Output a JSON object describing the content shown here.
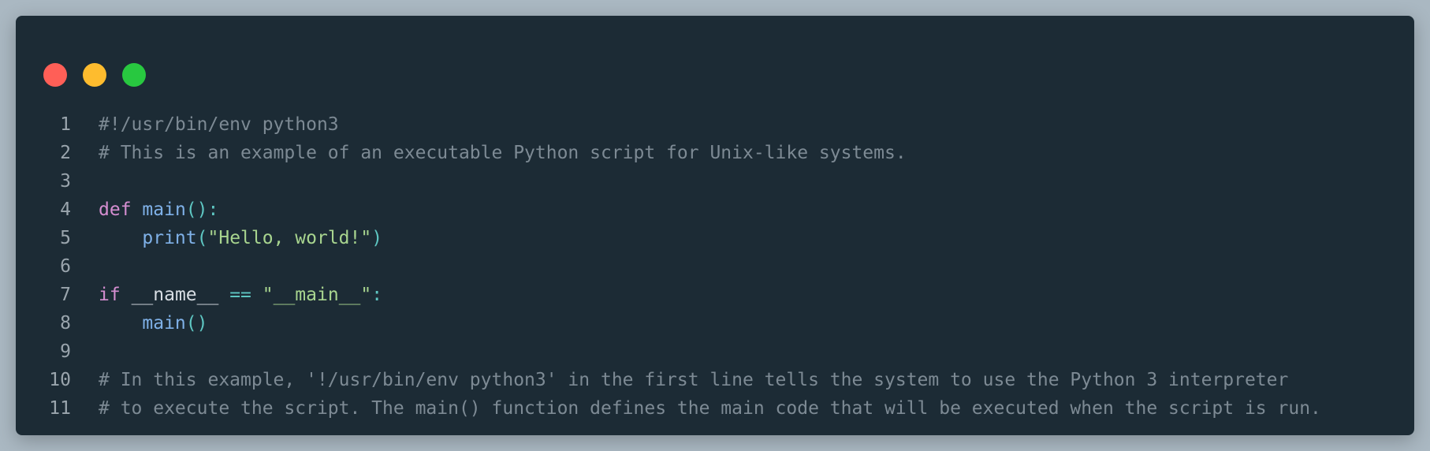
{
  "window": {
    "controls": [
      "close",
      "minimize",
      "maximize"
    ]
  },
  "code": {
    "line_numbers": [
      "1",
      "2",
      "3",
      "4",
      "5",
      "6",
      "7",
      "8",
      "9",
      "10",
      "11"
    ],
    "lines": {
      "l1": "#!/usr/bin/env python3",
      "l2": "# This is an example of an executable Python script for Unix-like systems.",
      "l4_def": "def",
      "l4_name": "main",
      "l4_paren": "():",
      "l5_indent": "    ",
      "l5_fn": "print",
      "l5_open": "(",
      "l5_str": "\"Hello, world!\"",
      "l5_close": ")",
      "l7_if": "if",
      "l7_name": "__name__",
      "l7_eq": "==",
      "l7_str": "\"__main__\"",
      "l7_colon": ":",
      "l8_indent": "    ",
      "l8_fn": "main",
      "l8_paren": "()",
      "l10": "# In this example, '!/usr/bin/env python3' in the first line tells the system to use the Python 3 interpreter",
      "l11": "# to execute the script. The main() function defines the main code that will be executed when the script is run."
    }
  },
  "colors": {
    "background": "#1c2b35",
    "comment": "#7d8a94",
    "keyword": "#d58ed1",
    "function": "#7fb1e8",
    "string": "#a8d58f",
    "punctuation": "#5ec6c2"
  }
}
